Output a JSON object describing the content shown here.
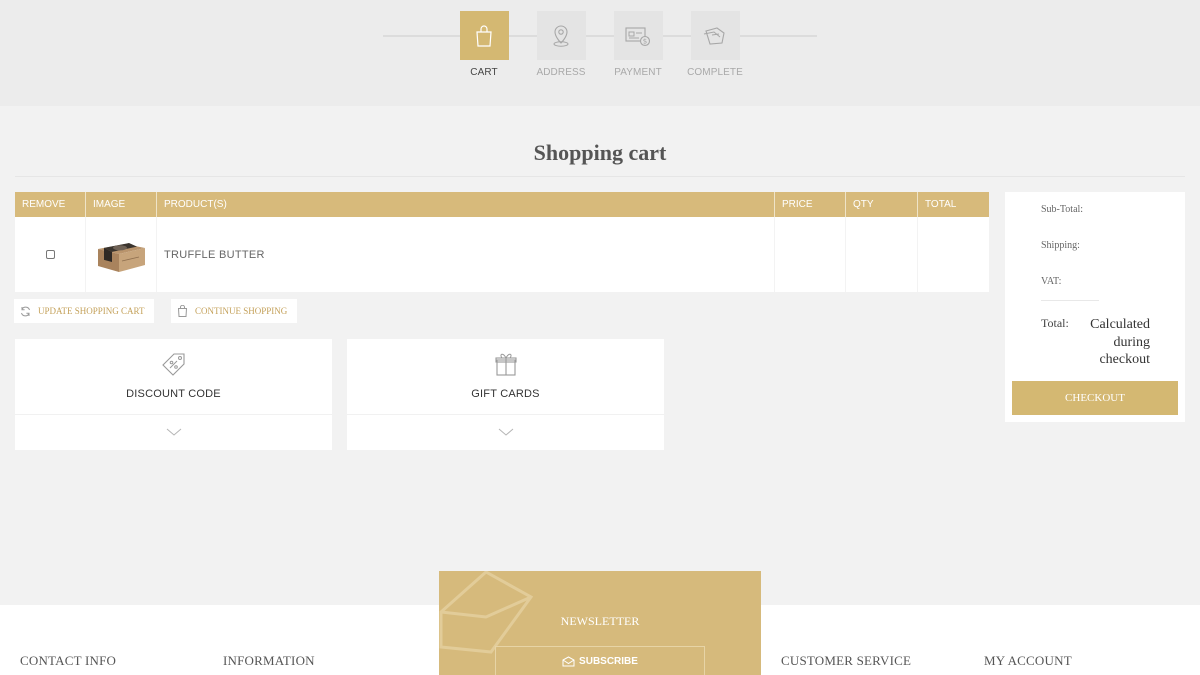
{
  "steps": [
    {
      "label": "CART",
      "icon": "shopping-bag-icon",
      "active": true
    },
    {
      "label": "ADDRESS",
      "icon": "location-pin-icon",
      "active": false
    },
    {
      "label": "PAYMENT",
      "icon": "payment-card-icon",
      "active": false
    },
    {
      "label": "COMPLETE",
      "icon": "complete-tags-icon",
      "active": false
    }
  ],
  "page_title": "Shopping cart",
  "table": {
    "headers": [
      "REMOVE",
      "IMAGE",
      "PRODUCT(S)",
      "PRICE",
      "QTY",
      "TOTAL"
    ],
    "rows": [
      {
        "remove_checked": false,
        "product": "TRUFFLE BUTTER",
        "price": "",
        "qty": "",
        "total": ""
      }
    ]
  },
  "buttons": {
    "update_cart": "UPDATE SHOPPING CART",
    "continue_shopping": "CONTINUE SHOPPING"
  },
  "panels": {
    "discount": "DISCOUNT CODE",
    "gift_cards": "GIFT CARDS"
  },
  "totals": {
    "subtotal_label": "Sub-Total:",
    "shipping_label": "Shipping:",
    "vat_label": "VAT:",
    "total_label": "Total:",
    "total_value": "Calculated during checkout",
    "checkout_label": "CHECKOUT"
  },
  "footer": {
    "contact": "CONTACT INFO",
    "information": "INFORMATION",
    "newsletter_title": "NEWSLETTER",
    "subscribe": "SUBSCRIBE",
    "customer_service": "CUSTOMER SERVICE",
    "my_account": "MY ACCOUNT"
  },
  "colors": {
    "accent": "#d4b872",
    "table_header": "#d7ba7b",
    "link_gold": "#c4a15a",
    "background": "#f2f2f2"
  }
}
